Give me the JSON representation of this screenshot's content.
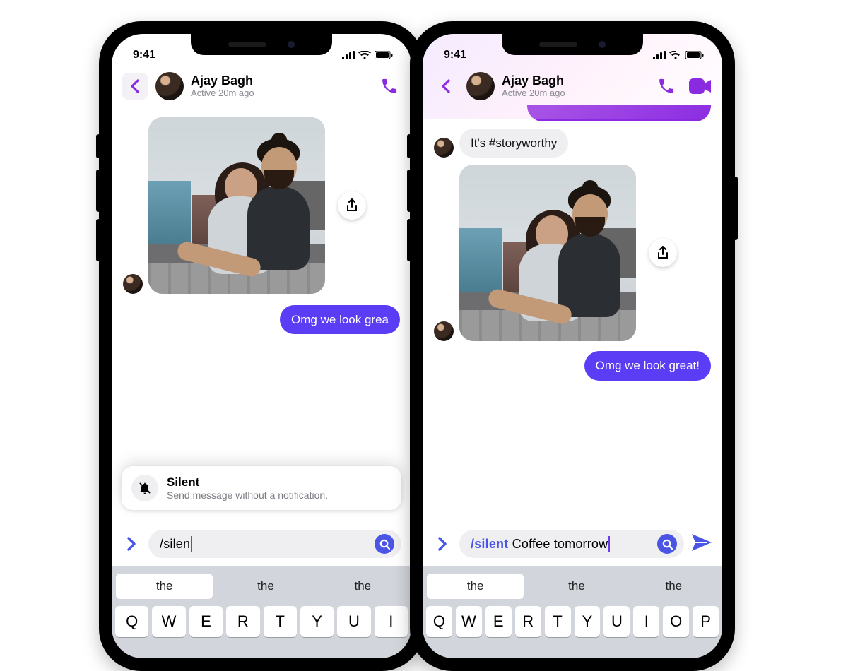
{
  "status": {
    "time": "9:41"
  },
  "chat": {
    "contact_name": "Ajay Bagh",
    "presence": "Active 20m ago"
  },
  "left_phone": {
    "msg_sent": "Omg we look grea",
    "suggestion": {
      "title": "Silent",
      "desc": "Send message without a notification."
    },
    "input_typed": "/silen",
    "kbd_suggestions": [
      "the",
      "the",
      "the"
    ],
    "kbd_row1": [
      "Q",
      "W",
      "E",
      "R",
      "T",
      "Y",
      "U",
      "I"
    ]
  },
  "right_phone": {
    "msg_recv": "It's #storyworthy",
    "msg_sent": "Omg we look great!",
    "input_cmd": "/silent",
    "input_rest": " Coffee tomorrow",
    "kbd_suggestions": [
      "the",
      "the",
      "the"
    ],
    "kbd_row1": [
      "Q",
      "W",
      "E",
      "R",
      "T",
      "Y",
      "U",
      "I",
      "O",
      "P"
    ]
  },
  "colors": {
    "accent": "#8a2be2",
    "bubble_sent": "#5b3df5",
    "link": "#4a55e6"
  }
}
